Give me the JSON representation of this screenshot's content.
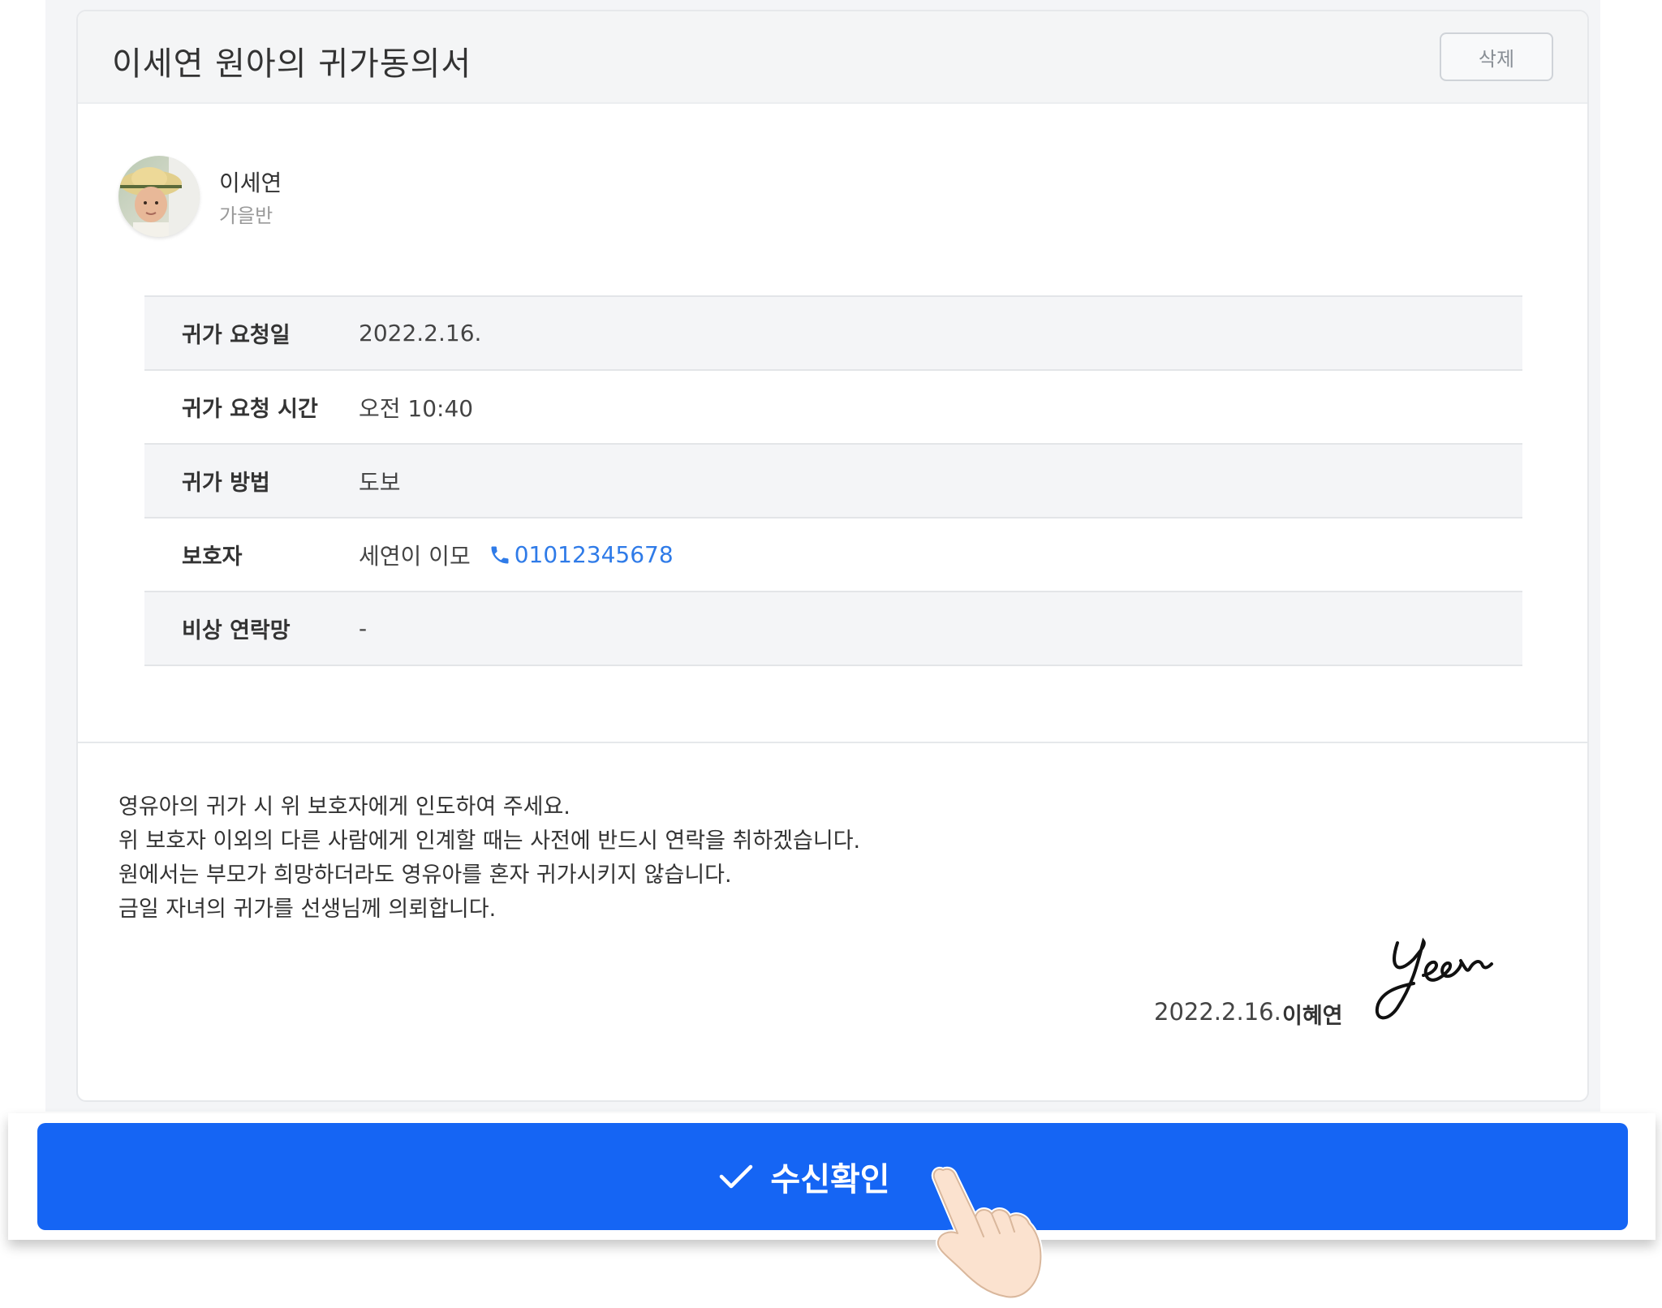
{
  "card": {
    "title": "이세연 원아의 귀가동의서",
    "delete_label": "삭제"
  },
  "child": {
    "name": "이세연",
    "class": "가을반",
    "avatar_icon": "child-photo-avatar"
  },
  "details": [
    {
      "label": "귀가 요청일",
      "value": "2022.2.16."
    },
    {
      "label": "귀가 요청 시간",
      "value": "오전 10:40"
    },
    {
      "label": "귀가 방법",
      "value": "도보"
    },
    {
      "label": "보호자",
      "value": "세연이 이모",
      "phone": "01012345678"
    },
    {
      "label": "비상 연락망",
      "value": "-"
    }
  ],
  "notice": [
    "영유아의 귀가 시 위 보호자에게 인도하여 주세요.",
    "위 보호자 이외의 다른 사람에게 인계할 때는 사전에 반드시 연락을 취하겠습니다.",
    "원에서는 부모가 희망하더라도 영유아를 혼자 귀가시키지 않습니다.",
    "금일 자녀의 귀가를 선생님께 의뢰합니다."
  ],
  "signature": {
    "date": "2022.2.16.",
    "name": "이혜연"
  },
  "confirm": {
    "label": "수신확인",
    "icon": "check-icon"
  },
  "colors": {
    "primary": "#1565f4",
    "link": "#2f7be8",
    "header_bg": "#f4f5f6",
    "row_shade": "#f4f5f7"
  }
}
